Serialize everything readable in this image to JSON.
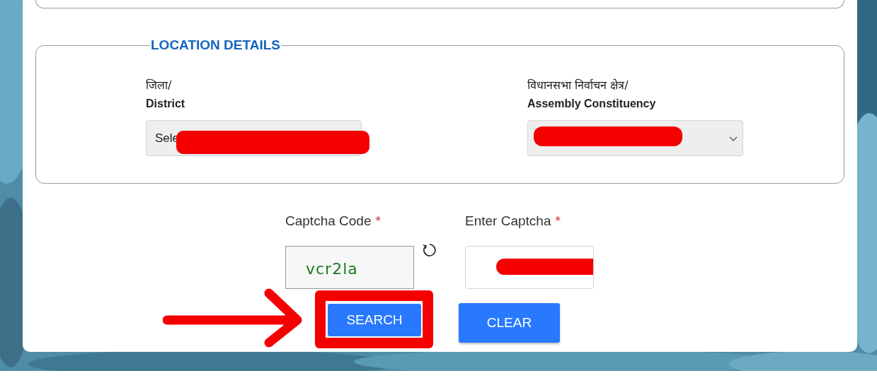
{
  "section": {
    "legend": "LOCATION DETAILS",
    "fields": [
      {
        "label_hindi": "जिला/",
        "label": "District",
        "value": "Sele",
        "dropdown": false,
        "redacted": true
      },
      {
        "label_hindi": "विधानसभा निर्वाचन क्षेत्र/",
        "label": "Assembly Constituency",
        "dropdown": true,
        "redacted": true
      }
    ]
  },
  "captcha": {
    "label": "Captcha Code",
    "required_mark": "*",
    "code": "vcr2la"
  },
  "captcha_input": {
    "label": "Enter Captcha",
    "required_mark": "*",
    "redacted": true
  },
  "buttons": [
    {
      "label": "SEARCH",
      "highlighted": true
    },
    {
      "label": "CLEAR",
      "highlighted": false
    }
  ]
}
